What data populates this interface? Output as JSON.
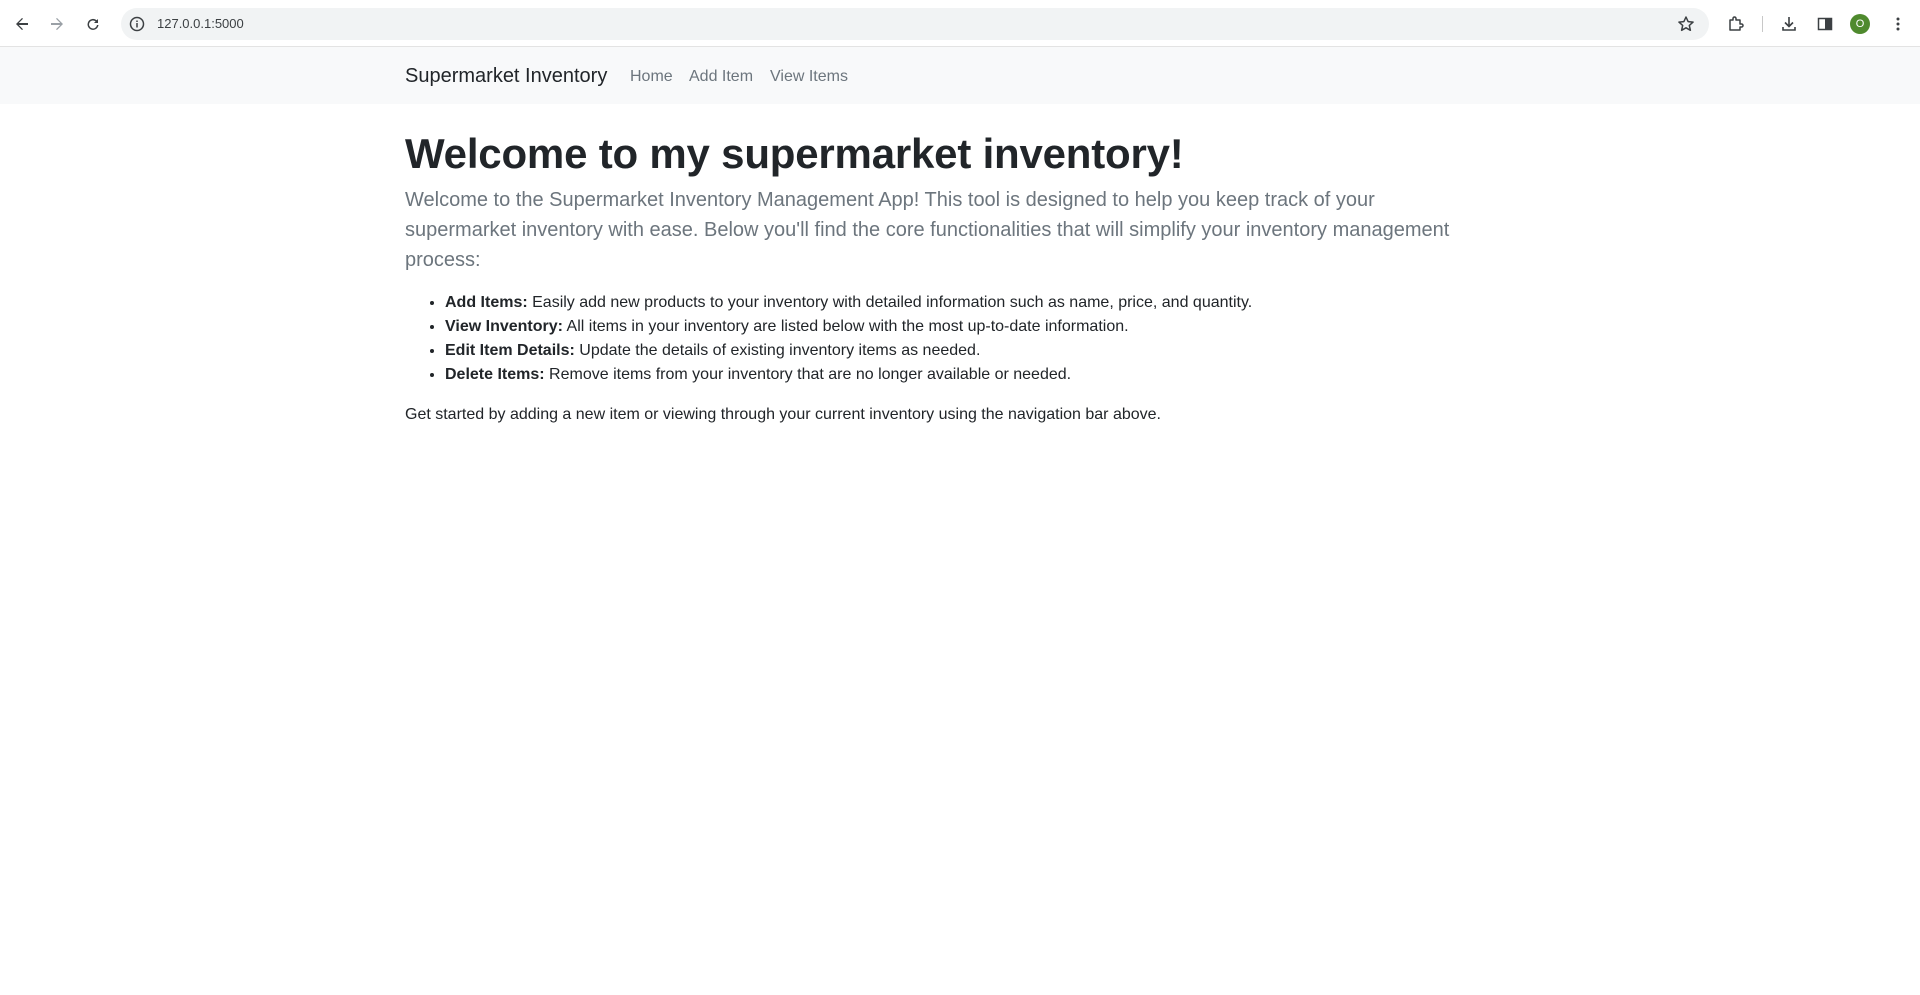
{
  "browser": {
    "url": "127.0.0.1:5000",
    "profile_initial": "O",
    "icons": [
      "back-arrow-icon",
      "forward-arrow-icon",
      "reload-icon",
      "info-icon",
      "star-icon",
      "extensions-icon",
      "download-icon",
      "side-panel-icon",
      "menu-dots-icon"
    ]
  },
  "navbar": {
    "brand": "Supermarket Inventory",
    "links": [
      "Home",
      "Add Item",
      "View Items"
    ]
  },
  "main": {
    "title": "Welcome to my supermarket inventory!",
    "lead": "Welcome to the Supermarket Inventory Management App! This tool is designed to help you keep track of your supermarket inventory with ease. Below you'll find the core functionalities that will simplify your inventory management process:",
    "features": [
      {
        "label": "Add Items:",
        "text": " Easily add new products to your inventory with detailed information such as name, price, and quantity."
      },
      {
        "label": "View Inventory:",
        "text": " All items in your inventory are listed below with the most up-to-date information."
      },
      {
        "label": "Edit Item Details:",
        "text": " Update the details of existing inventory items as needed."
      },
      {
        "label": "Delete Items:",
        "text": " Remove items from your inventory that are no longer available or needed."
      }
    ],
    "outro": "Get started by adding a new item or viewing through your current inventory using the navigation bar above."
  },
  "colors": {
    "navbar_bg": "#f8f9fa",
    "link_muted": "#6c757d",
    "text": "#212529",
    "avatar": "#4f8a2e"
  }
}
